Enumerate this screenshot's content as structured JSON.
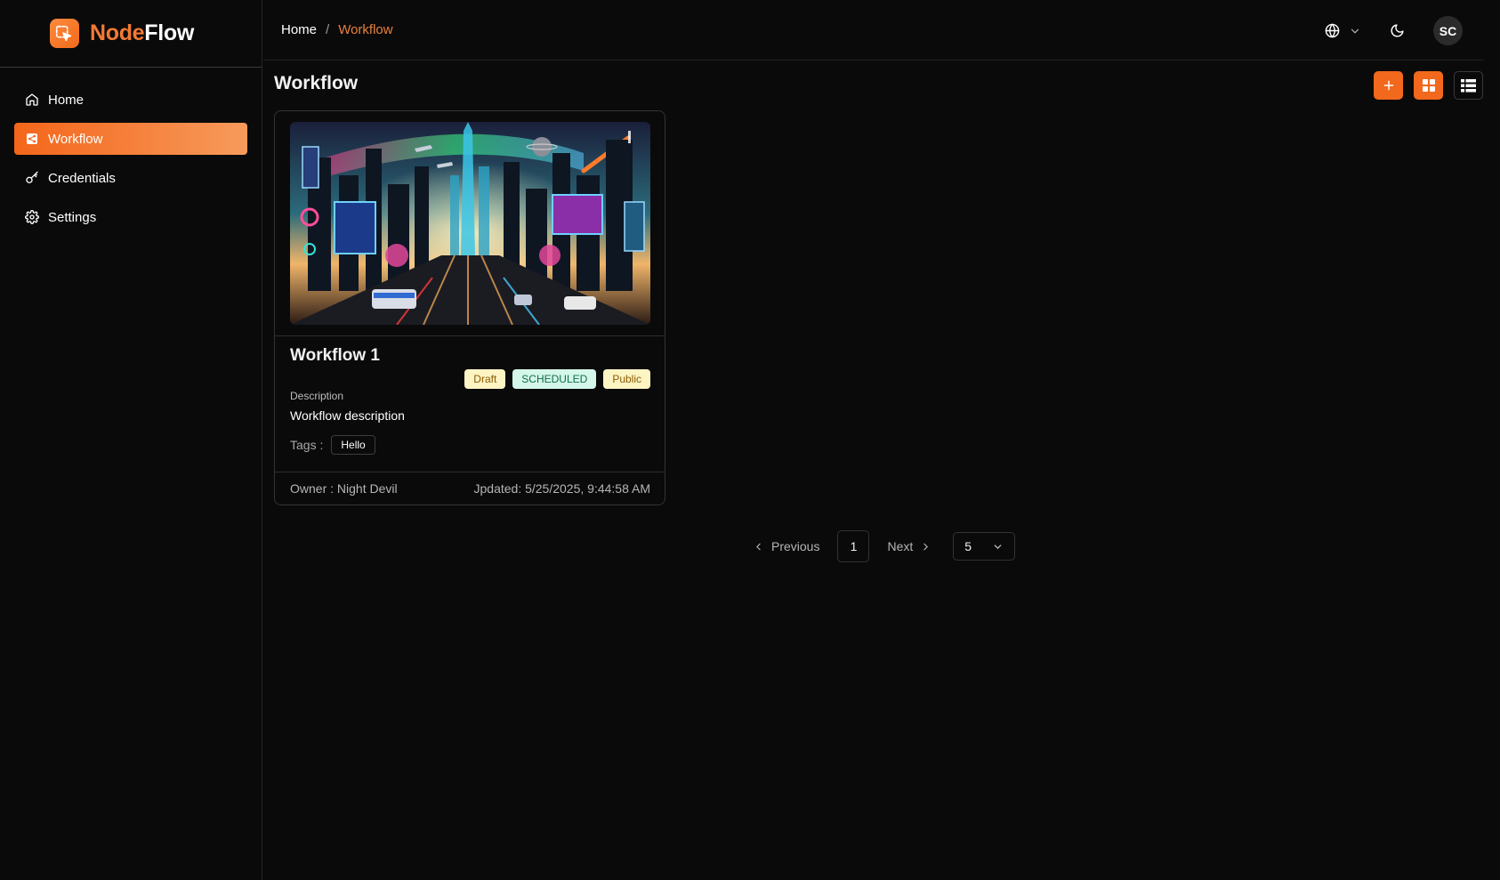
{
  "app": {
    "name_part1": "Node",
    "name_part2": "Flow"
  },
  "sidebar": {
    "items": [
      {
        "label": "Home",
        "icon": "home-icon",
        "active": false
      },
      {
        "label": "Workflow",
        "icon": "workflow-icon",
        "active": true
      },
      {
        "label": "Credentials",
        "icon": "key-icon",
        "active": false
      },
      {
        "label": "Settings",
        "icon": "gear-icon",
        "active": false
      }
    ]
  },
  "header": {
    "breadcrumb": {
      "home": "Home",
      "separator": "/",
      "current": "Workflow"
    },
    "avatar_initials": "SC"
  },
  "main": {
    "title": "Workflow"
  },
  "workflows": [
    {
      "title": "Workflow 1",
      "badges": [
        "Draft",
        "SCHEDULED",
        "Public"
      ],
      "description_label": "Description",
      "description": "Workflow description",
      "tags_label": "Tags :",
      "tags": [
        "Hello"
      ],
      "owner": "Owner : Night Devil",
      "updated": "Jpdated: 5/25/2025, 9:44:58 AM"
    }
  ],
  "pagination": {
    "previous_label": "Previous",
    "current_page": "1",
    "next_label": "Next",
    "page_size": "5"
  },
  "colors": {
    "accent": "#f2681c",
    "background": "#0b0a0a",
    "badge_draft_bg": "#fdf4c4",
    "badge_scheduled_bg": "#d4f7ea"
  }
}
